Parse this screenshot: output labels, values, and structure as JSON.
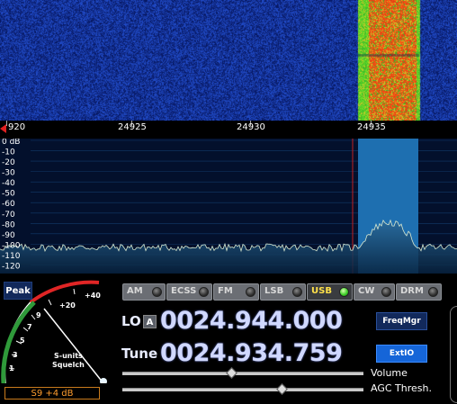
{
  "waterfall": {
    "background_color": "#0a1a7a",
    "signal_color_hot": "#d81818",
    "signal_color_warm": "#2fc23a"
  },
  "frequency_ruler": {
    "labels": [
      "920",
      "24925",
      "24930",
      "24935"
    ],
    "marker_color": "#e02020"
  },
  "spectrum": {
    "db_labels": [
      "0 dB",
      "-10",
      "-20",
      "-30",
      "-40",
      "-50",
      "-60",
      "-70",
      "-80",
      "-90",
      "-100",
      "-110",
      "-120"
    ],
    "passband_color": "#1e6fb0",
    "tuning_line_color": "#c02020"
  },
  "controls": {
    "peak_label": "Peak",
    "smeter": {
      "scale_labels": [
        "1",
        "3",
        "5",
        "7",
        "9",
        "+20",
        "+40"
      ],
      "title_line1": "S-units",
      "title_line2": "Squelch",
      "readout": "S9 +4 dB"
    },
    "modes": [
      {
        "label": "AM"
      },
      {
        "label": "ECSS"
      },
      {
        "label": "FM"
      },
      {
        "label": "LSB"
      },
      {
        "label": "USB"
      },
      {
        "label": "CW"
      },
      {
        "label": "DRM"
      }
    ],
    "active_mode": "USB",
    "lo_label": "LO",
    "lo_a_label": "A",
    "lo_frequency": "0024.944.000",
    "tune_label": "Tune",
    "tune_frequency": "0024.934.759",
    "freqmgr_label": "FreqMgr",
    "extio_label": "ExtIO",
    "volume_label": "Volume",
    "agc_label": "AGC Thresh.",
    "volume_level": 0.45,
    "agc_level": 0.66
  }
}
